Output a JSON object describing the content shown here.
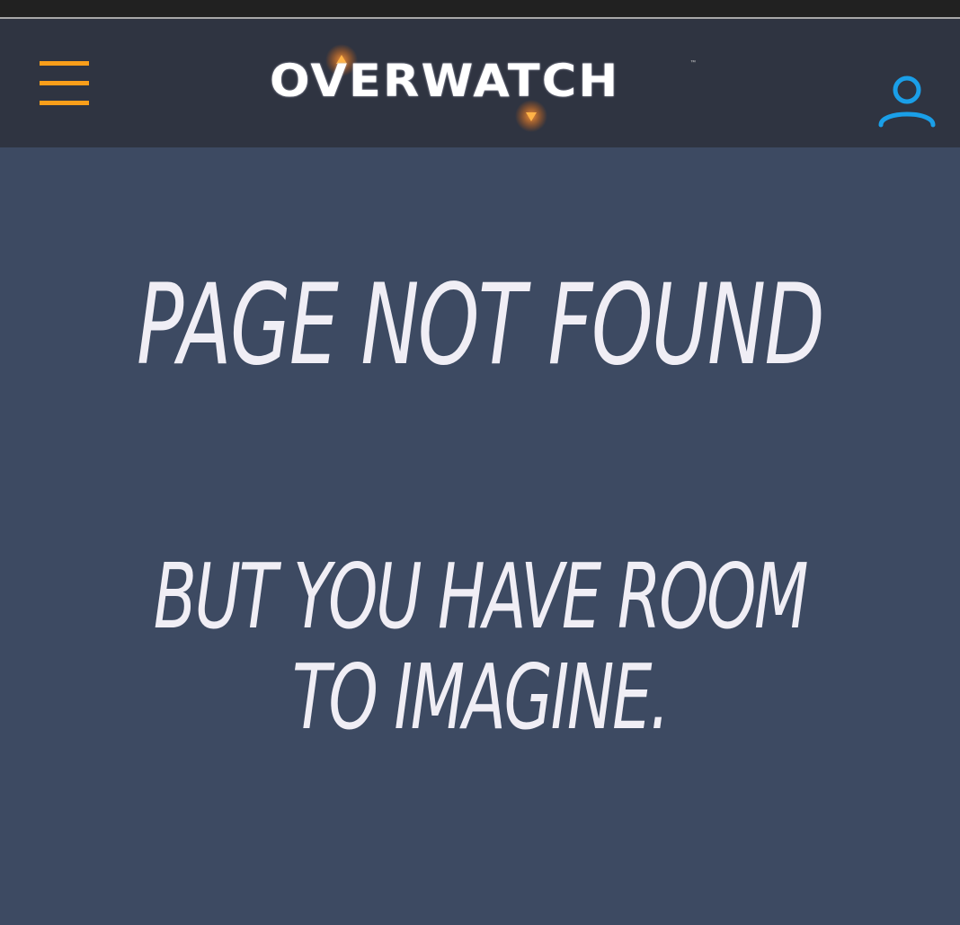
{
  "header": {
    "menu_icon": "hamburger-menu-icon",
    "logo_text": "OVERWATCH",
    "logo_tm": "™",
    "user_icon": "user-account-icon",
    "colors": {
      "menu_accent": "#f99e1a",
      "user_accent": "#1a9fe8",
      "header_bg": "#2f3441",
      "page_bg": "#3d4a62"
    }
  },
  "main": {
    "headline": "PAGE NOT FOUND",
    "subline": "BUT YOU HAVE ROOM TO IMAGINE."
  }
}
